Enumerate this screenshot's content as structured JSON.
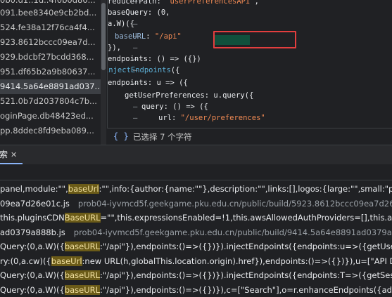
{
  "file_list": {
    "items": [
      "091.bee8340e9cb2bd...",
      "524.fe38a12f76ca4f4...",
      "923.8612bccc09ea7d...",
      "929.bdcbf27bcdd368...",
      "951.df65b2a9b80637...",
      "9414.5a64e8891ad037...",
      "521.0b7d2037804c7b...",
      "oginPage.db48423ed...",
      "pp.8ddec8fd9eba089..."
    ],
    "top_partial": "0b0.d1..1d..4f0b0d80..."
  },
  "code": {
    "lines": [
      {
        "parts": [
          [
            "p",
            "reducerPath: "
          ],
          [
            "s",
            "\"userPreferencesAPI\""
          ],
          [
            "p",
            ","
          ]
        ]
      },
      {
        "parts": [
          [
            "p",
            "baseQuery: (0,"
          ]
        ]
      },
      {
        "parts": [
          [
            "p",
            "a.W)({"
          ]
        ]
      },
      {
        "parts": [
          [
            "v",
            "baseURL"
          ],
          [
            "p",
            ": "
          ],
          [
            "s",
            "\"/api\""
          ]
        ]
      },
      {
        "parts": [
          [
            "p",
            "}),"
          ]
        ]
      },
      {
        "parts": [
          [
            "p",
            "endpoints: () => ({})"
          ]
        ]
      },
      {
        "parts": [
          [
            "p",
            "})."
          ],
          [
            "k",
            "injectEndpoints"
          ],
          [
            "p",
            "({"
          ]
        ]
      },
      {
        "parts": [
          [
            "p",
            "endpoints: u => ({"
          ]
        ]
      },
      {
        "parts": [
          [
            "p",
            "getUserPreferences: u.query({"
          ]
        ]
      },
      {
        "parts": [
          [
            "p",
            "query: () => ({"
          ]
        ]
      },
      {
        "parts": [
          [
            "p",
            "url: "
          ],
          [
            "s",
            "\"/user/preferences\""
          ]
        ]
      }
    ]
  },
  "status_bar": {
    "icon": "braces-icon",
    "icon_glyph": "{ }",
    "selection_text": "已选择 7 个字符"
  },
  "search_panel": {
    "tab_label": "搜索",
    "tab_close": "✕"
  },
  "results": [
    {
      "kind": "line",
      "segments": [
        [
          "",
          "panel,module:\"\","
        ],
        [
          "hl",
          "baseUrl"
        ],
        [
          "",
          ":\"\",info:{author:{name:\"\"},description:\"\",links:[],logos:{large:\"\",small:\"public/"
        ]
      ]
    },
    {
      "kind": "file",
      "name": "09ea7d26e01c.js",
      "path": "prob04-iyvmcd5f.geekgame.pku.edu.cn/public/build/5923.8612bccc09ea7d26e"
    },
    {
      "kind": "line",
      "segments": [
        [
          "",
          "this.pluginsCDN"
        ],
        [
          "hl",
          "BaseURL"
        ],
        [
          "",
          "=\"\",this.expressionsEnabled=!1,this.awsAllowedAuthProviders=[],this.awsA"
        ]
      ]
    },
    {
      "kind": "file",
      "name": "ad0379a888b.js",
      "path": "prob04-iyvmcd5f.geekgame.pku.edu.cn/public/build/9414.5a64e8891ad0379a8"
    },
    {
      "kind": "line",
      "segments": [
        [
          "",
          "Query:(0,a.W)({"
        ],
        [
          "hl",
          "baseURL"
        ],
        [
          "",
          ":\"/api\"}),endpoints:()=>({})}).injectEndpoints({endpoints:u=>({getUserPrefere"
        ]
      ]
    },
    {
      "kind": "line",
      "segments": [
        [
          "",
          "ry:(0,a.cw)({"
        ],
        [
          "hl",
          "baseUrl"
        ],
        [
          "",
          ":new URL(h,globalThis.location.origin).href}),endpoints:()=>({})}),u=[\"API Discov"
        ]
      ]
    },
    {
      "kind": "line",
      "segments": [
        [
          "",
          "Query:(0,a.W)({"
        ],
        [
          "hl",
          "baseURL"
        ],
        [
          "",
          ":\"/api\"}),endpoints:()=>({})}).injectEndpoints({endpoints:T=>({getSessionList"
        ]
      ]
    },
    {
      "kind": "line",
      "segments": [
        [
          "",
          "Query:(0,a.W)({"
        ],
        [
          "hl",
          "baseURL"
        ],
        [
          "",
          ":\"/api\"}),endpoints:()=>({})}),c=[\"Search\"],o=r.enhanceEndpoints({addTagTypes:c})"
        ]
      ]
    }
  ]
}
